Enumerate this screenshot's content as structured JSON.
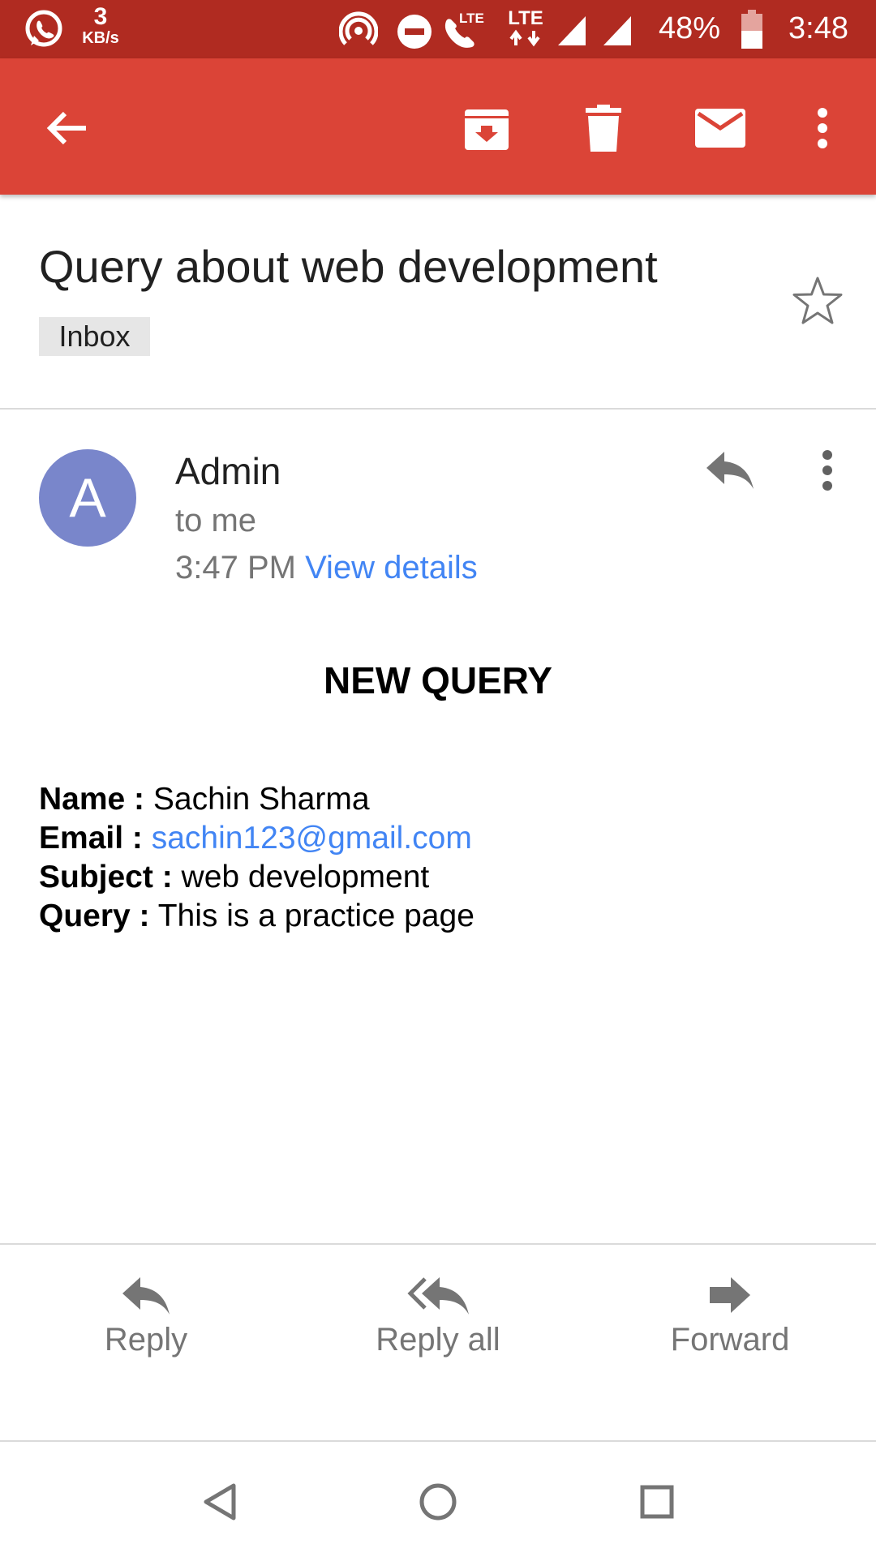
{
  "status_bar": {
    "speed_value": "3",
    "speed_unit": "KB/s",
    "lte_1": "LTE",
    "lte_2": "LTE",
    "battery": "48%",
    "time": "3:48"
  },
  "toolbar": {
    "icons": [
      "arrow-back-icon",
      "archive-icon",
      "delete-icon",
      "mark-unread-icon",
      "more-vert-icon"
    ]
  },
  "email": {
    "subject": "Query about web development",
    "label": "Inbox",
    "sender_name": "Admin",
    "sender_initial": "A",
    "recipient": "to me",
    "time": "3:47 PM",
    "view_details": "View details"
  },
  "body": {
    "heading": "NEW QUERY",
    "fields": [
      {
        "label": "Name :",
        "value": "Sachin Sharma"
      },
      {
        "label": "Email :",
        "value": "sachin123@gmail.com"
      },
      {
        "label": "Subject :",
        "value": "web development"
      },
      {
        "label": "Query :",
        "value": "This is a practice page"
      }
    ]
  },
  "actions": {
    "reply": "Reply",
    "reply_all": "Reply all",
    "forward": "Forward"
  },
  "colors": {
    "status_bar": "#b02b21",
    "toolbar": "#db4437",
    "avatar": "#7986cb",
    "link": "#4285f4"
  }
}
